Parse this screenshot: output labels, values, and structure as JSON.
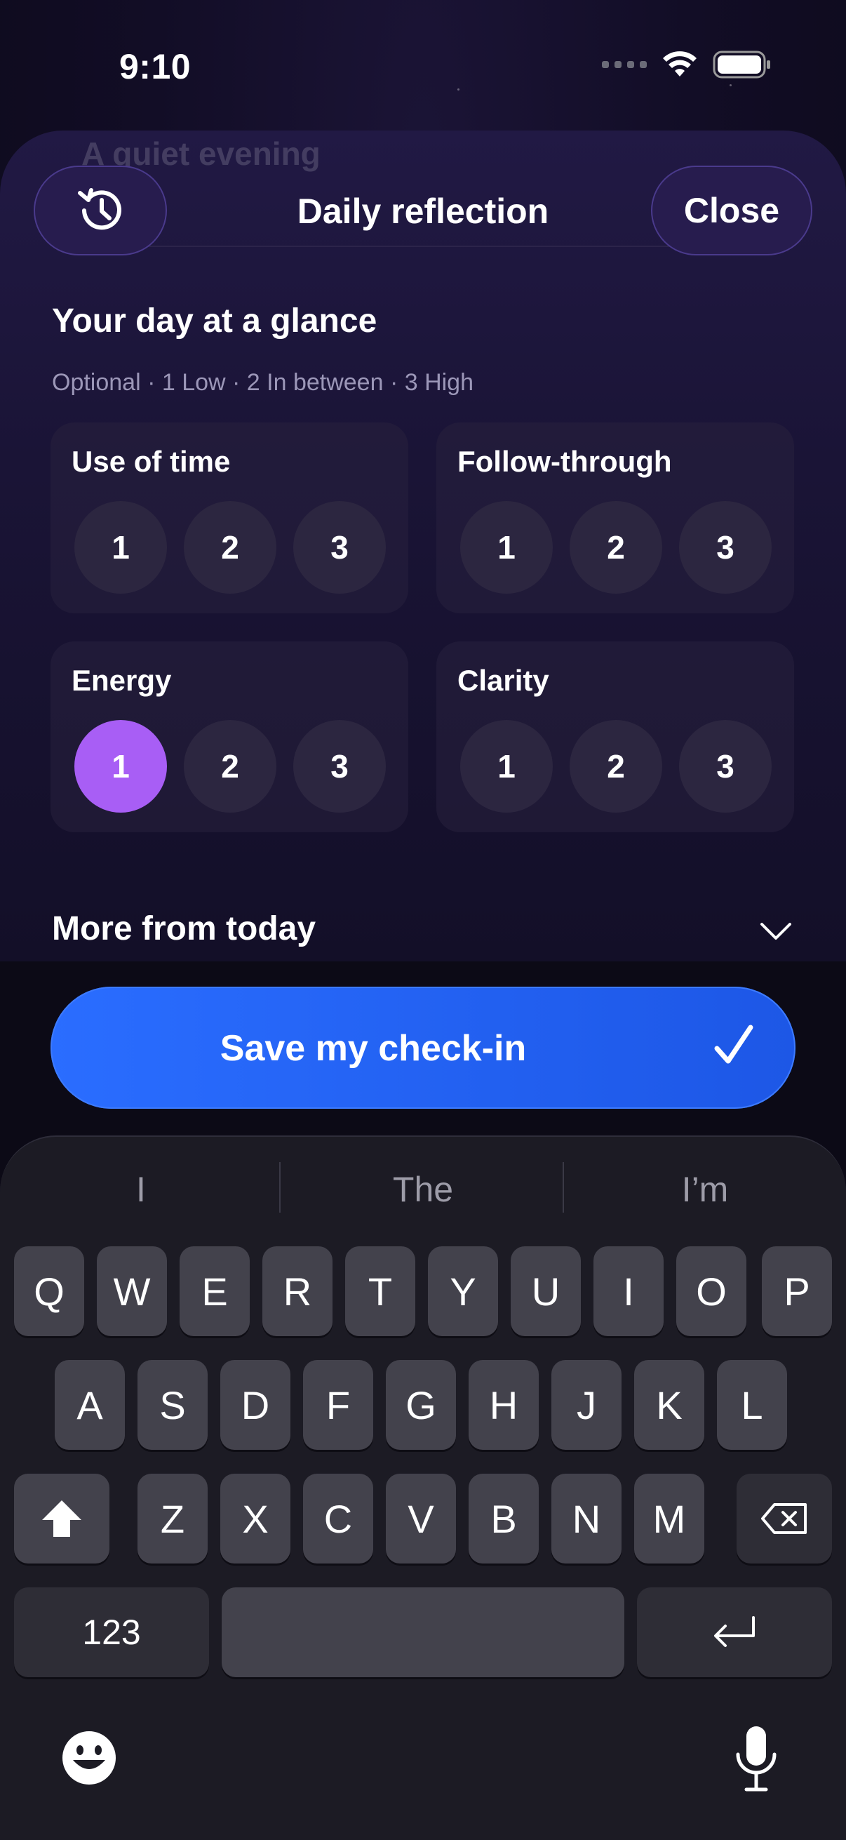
{
  "status_bar": {
    "time": "9:10"
  },
  "sheet": {
    "background_title": "A quiet evening",
    "title": "Daily reflection",
    "close_label": "Close",
    "history_icon": "history-icon"
  },
  "glance": {
    "title": "Your day at a glance",
    "subtitle": "Optional · 1 Low · 2 In between · 3 High",
    "metrics": [
      {
        "label": "Use of time",
        "options": [
          "1",
          "2",
          "3"
        ],
        "selected": null
      },
      {
        "label": "Follow-through",
        "options": [
          "1",
          "2",
          "3"
        ],
        "selected": null
      },
      {
        "label": "Energy",
        "options": [
          "1",
          "2",
          "3"
        ],
        "selected": "1"
      },
      {
        "label": "Clarity",
        "options": [
          "1",
          "2",
          "3"
        ],
        "selected": null
      }
    ]
  },
  "more_from_today": {
    "label": "More from today"
  },
  "save": {
    "label": "Save my check-in"
  },
  "colors": {
    "accent": "#a85ef5",
    "primary_button": "#2a6dff",
    "sheet_bg": "#1a1436"
  },
  "keyboard": {
    "suggestions": [
      "I",
      "The",
      "I’m"
    ],
    "row1": [
      "Q",
      "W",
      "E",
      "R",
      "T",
      "Y",
      "U",
      "I",
      "O",
      "P"
    ],
    "row2": [
      "A",
      "S",
      "D",
      "F",
      "G",
      "H",
      "J",
      "K",
      "L"
    ],
    "row3": [
      "Z",
      "X",
      "C",
      "V",
      "B",
      "N",
      "M"
    ],
    "numbers_label": "123"
  }
}
